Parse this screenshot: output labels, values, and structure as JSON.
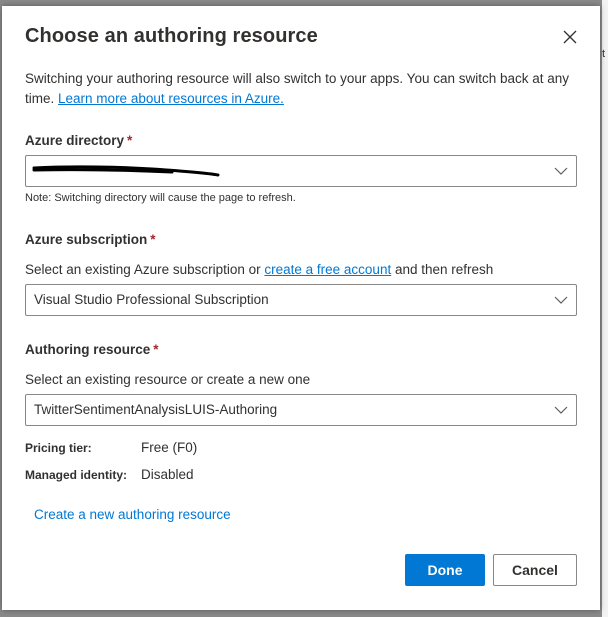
{
  "dialog": {
    "title": "Choose an authoring resource",
    "description": "Switching your authoring resource will also switch to your apps. You can switch back at any time.",
    "learn_more_link": "Learn more about resources in Azure.",
    "close_icon": "close-icon"
  },
  "directory": {
    "label": "Azure directory",
    "required_marker": "*",
    "value": "",
    "note": "Note: Switching directory will cause the page to refresh."
  },
  "subscription": {
    "label": "Azure subscription",
    "required_marker": "*",
    "helper_prefix": "Select an existing Azure subscription or ",
    "helper_link": "create a free account",
    "helper_suffix": " and then refresh",
    "value": "Visual Studio Professional Subscription"
  },
  "authoring": {
    "label": "Authoring resource",
    "required_marker": "*",
    "helper": "Select an existing resource or create a new one",
    "value": "TwitterSentimentAnalysisLUIS-Authoring"
  },
  "details": {
    "pricing_tier_label": "Pricing tier:",
    "pricing_tier_value": "Free (F0)",
    "managed_identity_label": "Managed identity:",
    "managed_identity_value": "Disabled"
  },
  "create_link": "Create a new authoring resource",
  "buttons": {
    "done": "Done",
    "cancel": "Cancel"
  },
  "backdrop": {
    "edge_text": "t"
  },
  "colors": {
    "accent": "#0078d4",
    "required": "#a4262c",
    "text": "#323130"
  }
}
